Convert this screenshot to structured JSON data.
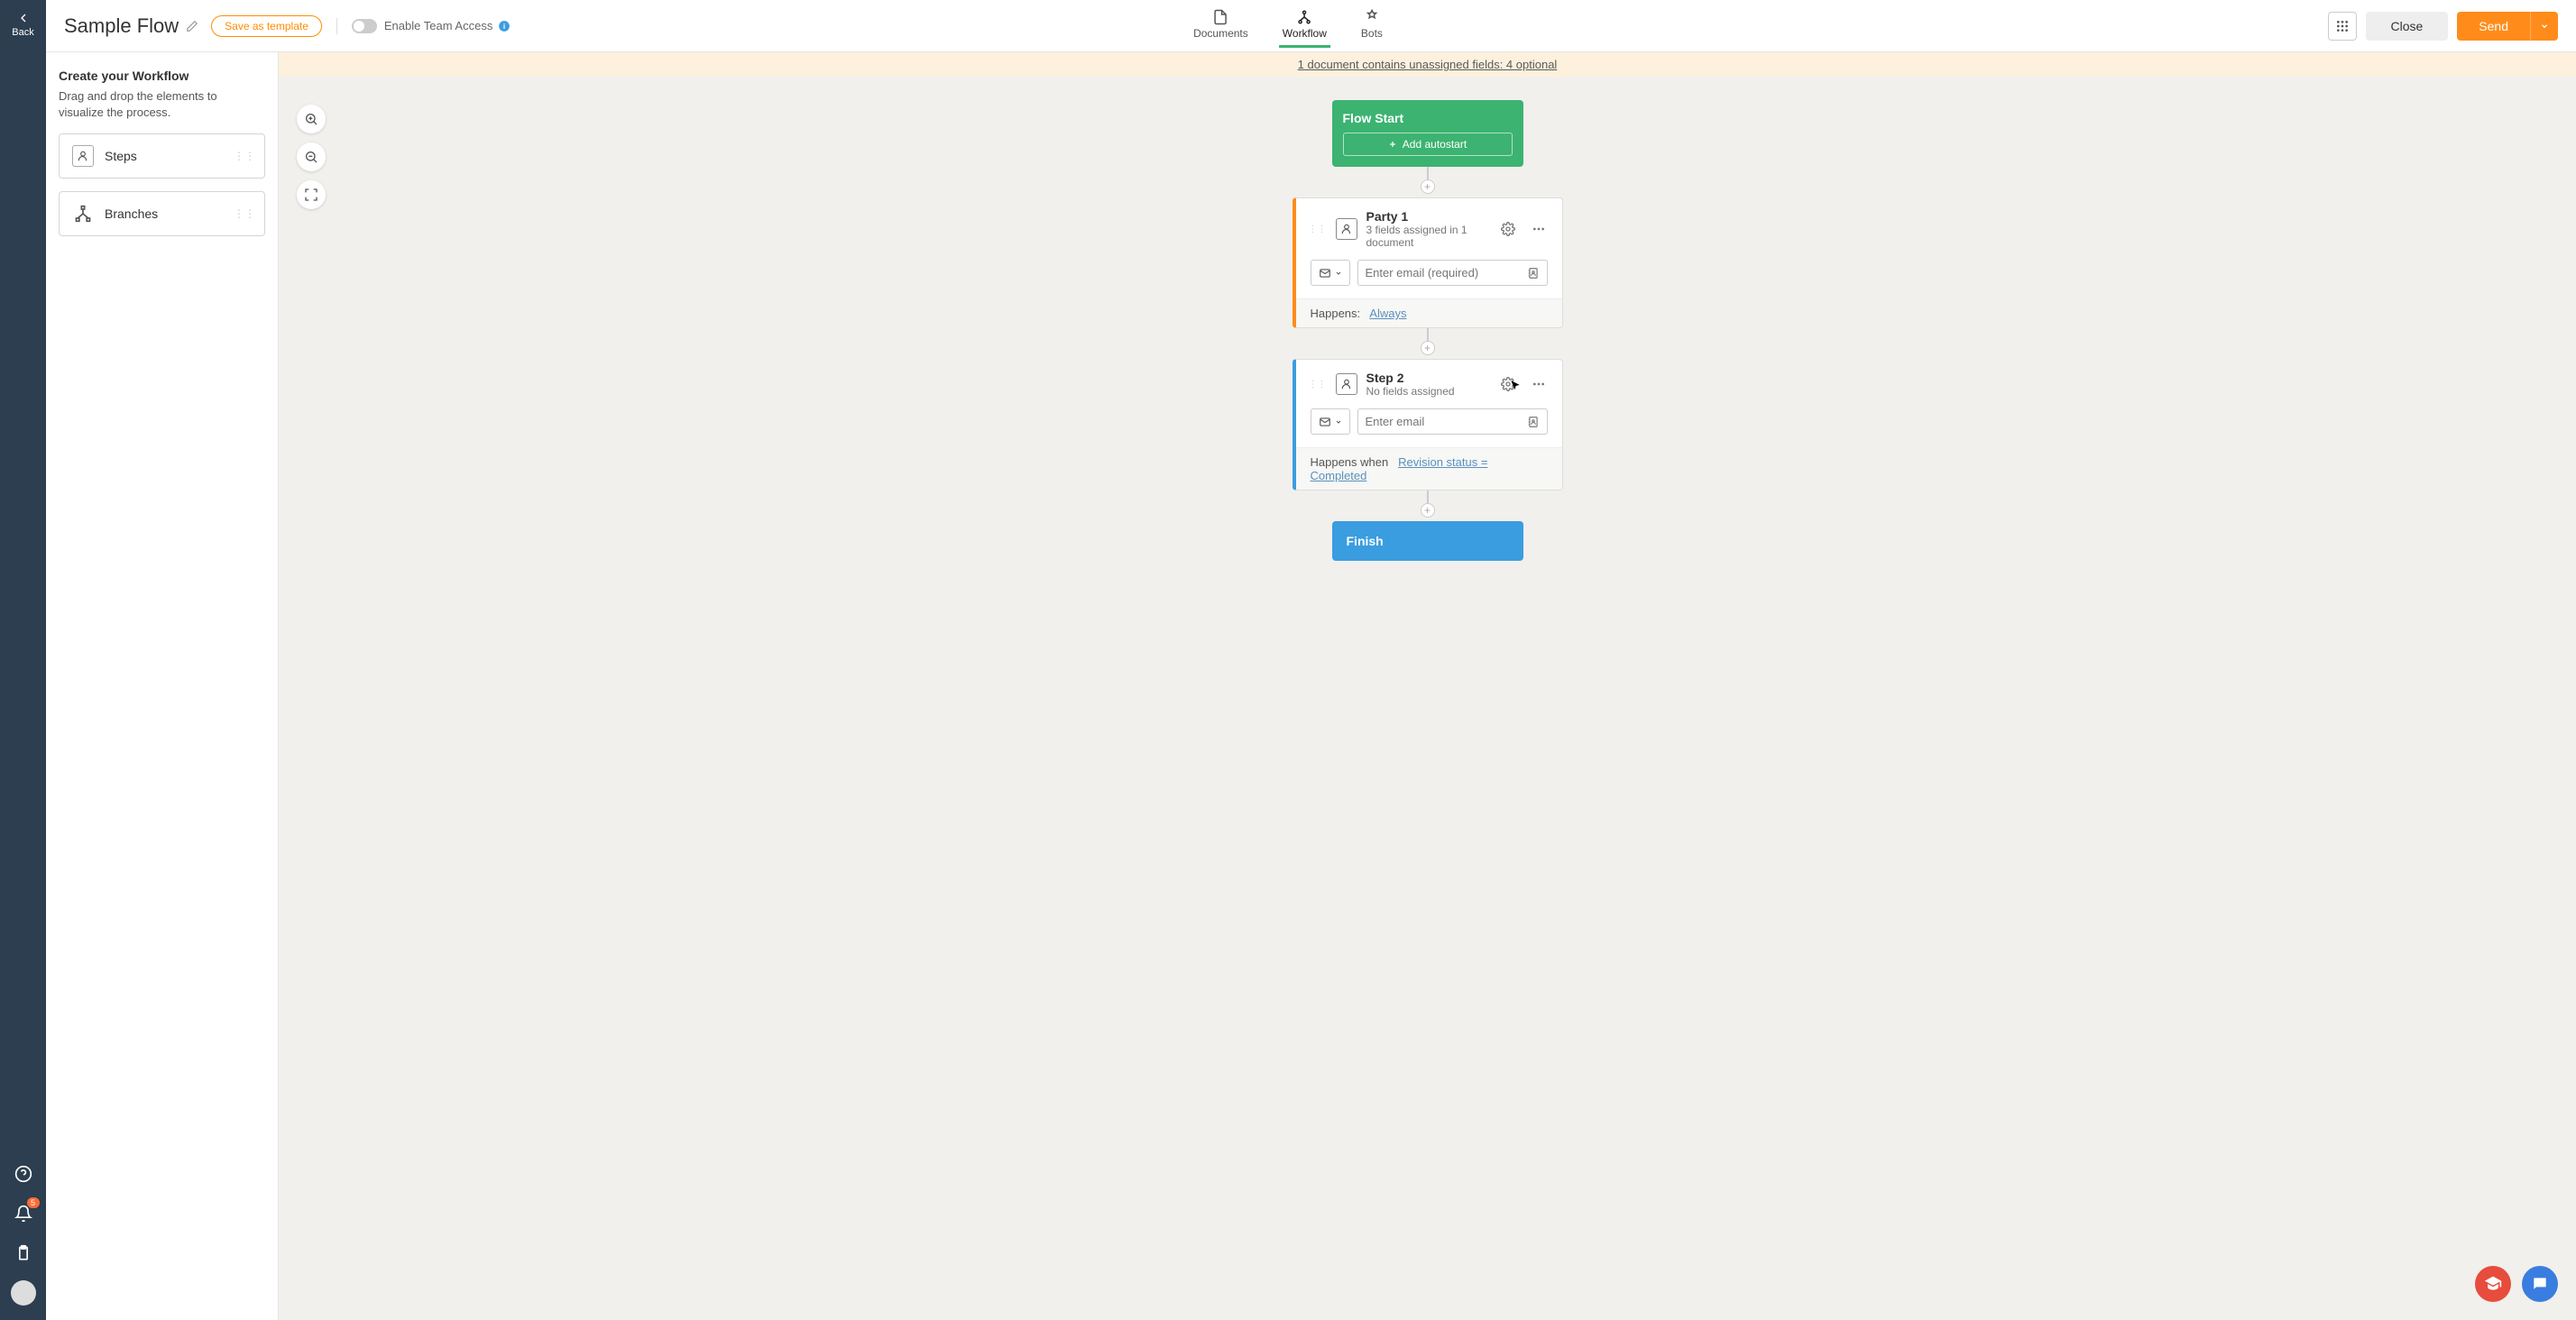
{
  "left_rail": {
    "back_label": "Back",
    "notif_count": "5"
  },
  "header": {
    "title": "Sample Flow",
    "save_template": "Save as template",
    "team_access": "Enable Team Access",
    "tabs": {
      "documents": "Documents",
      "workflow": "Workflow",
      "bots": "Bots"
    },
    "close": "Close",
    "send": "Send"
  },
  "sidebar": {
    "title": "Create your Workflow",
    "desc": "Drag and drop the elements to visualize the process.",
    "steps": "Steps",
    "branches": "Branches"
  },
  "warning": "1 document contains unassigned fields: 4 optional",
  "flow": {
    "start_title": "Flow Start",
    "add_autostart": "Add autostart",
    "step1": {
      "title": "Party 1",
      "sub": "3 fields assigned in 1 document",
      "email_placeholder": "Enter email (required)",
      "happens": "Happens:",
      "happens_link": "Always"
    },
    "step2": {
      "title": "Step 2",
      "sub": "No fields assigned",
      "email_placeholder": "Enter email",
      "happens": "Happens when",
      "happens_link": "Revision status = Completed"
    },
    "finish": "Finish"
  }
}
